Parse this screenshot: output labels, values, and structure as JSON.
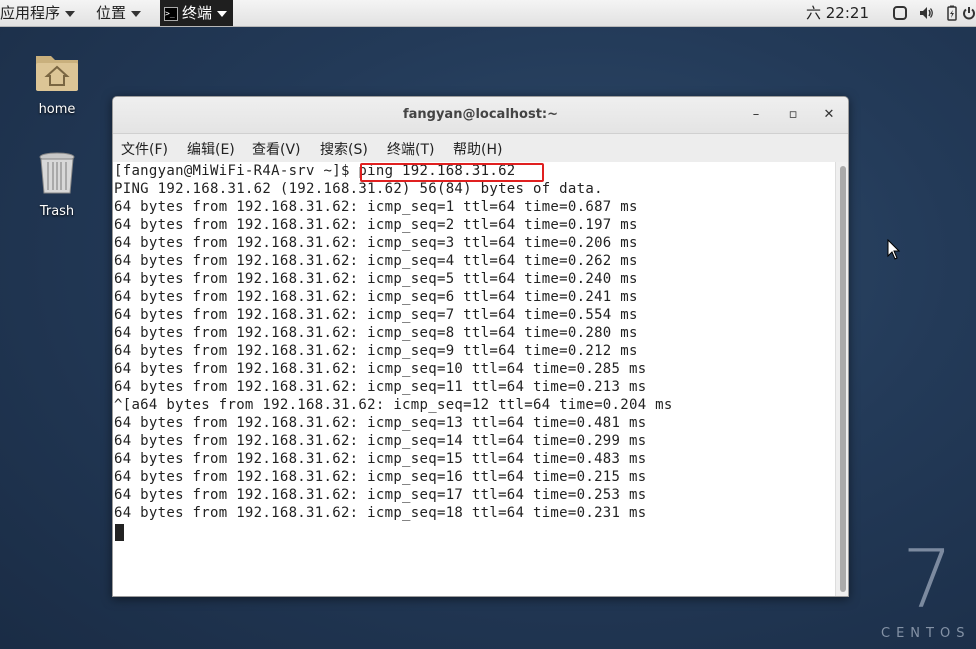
{
  "top_panel": {
    "applications": "应用程序",
    "places": "位置",
    "task_terminal": "终端",
    "clock": "六 22:21"
  },
  "desktop": {
    "icons": [
      {
        "label": "home",
        "icon": "home-folder-icon"
      },
      {
        "label": "Trash",
        "icon": "trash-icon"
      }
    ],
    "logo": {
      "number": "7",
      "word": "CENTOS"
    }
  },
  "window": {
    "title": "fangyan@localhost:~",
    "controls": {
      "minimize": "–",
      "maximize": "▫",
      "close": "✕"
    },
    "menu": [
      "文件(F)",
      "编辑(E)",
      "查看(V)",
      "搜索(S)",
      "终端(T)",
      "帮助(H)"
    ],
    "highlight_color": "#e02020",
    "terminal_lines": [
      "[fangyan@MiWiFi-R4A-srv ~]$ ping 192.168.31.62",
      "PING 192.168.31.62 (192.168.31.62) 56(84) bytes of data.",
      "64 bytes from 192.168.31.62: icmp_seq=1 ttl=64 time=0.687 ms",
      "64 bytes from 192.168.31.62: icmp_seq=2 ttl=64 time=0.197 ms",
      "64 bytes from 192.168.31.62: icmp_seq=3 ttl=64 time=0.206 ms",
      "64 bytes from 192.168.31.62: icmp_seq=4 ttl=64 time=0.262 ms",
      "64 bytes from 192.168.31.62: icmp_seq=5 ttl=64 time=0.240 ms",
      "64 bytes from 192.168.31.62: icmp_seq=6 ttl=64 time=0.241 ms",
      "64 bytes from 192.168.31.62: icmp_seq=7 ttl=64 time=0.554 ms",
      "64 bytes from 192.168.31.62: icmp_seq=8 ttl=64 time=0.280 ms",
      "64 bytes from 192.168.31.62: icmp_seq=9 ttl=64 time=0.212 ms",
      "64 bytes from 192.168.31.62: icmp_seq=10 ttl=64 time=0.285 ms",
      "64 bytes from 192.168.31.62: icmp_seq=11 ttl=64 time=0.213 ms",
      "^[a64 bytes from 192.168.31.62: icmp_seq=12 ttl=64 time=0.204 ms",
      "64 bytes from 192.168.31.62: icmp_seq=13 ttl=64 time=0.481 ms",
      "64 bytes from 192.168.31.62: icmp_seq=14 ttl=64 time=0.299 ms",
      "64 bytes from 192.168.31.62: icmp_seq=15 ttl=64 time=0.483 ms",
      "64 bytes from 192.168.31.62: icmp_seq=16 ttl=64 time=0.215 ms",
      "64 bytes from 192.168.31.62: icmp_seq=17 ttl=64 time=0.253 ms",
      "64 bytes from 192.168.31.62: icmp_seq=18 ttl=64 time=0.231 ms"
    ]
  }
}
